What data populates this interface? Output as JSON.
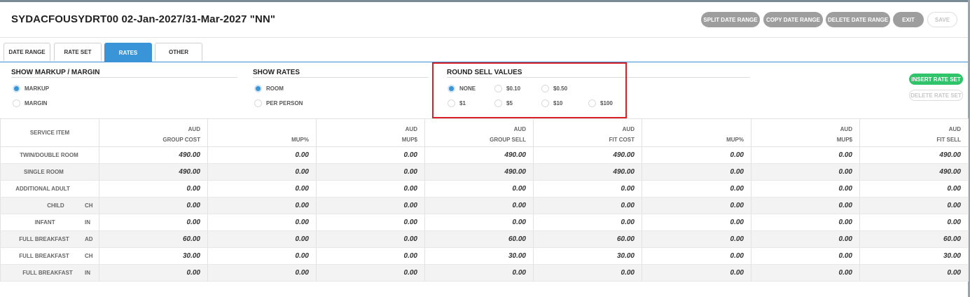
{
  "header": {
    "title": "SYDACFOUSYDRT00 02-Jan-2027/31-Mar-2027 \"NN\"",
    "buttons": {
      "split": "SPLIT DATE RANGE",
      "copy": "COPY DATE RANGE",
      "delete": "DELETE DATE RANGE",
      "exit": "EXIT",
      "save": "SAVE"
    }
  },
  "tabs": [
    "DATE RANGE",
    "RATE SET",
    "RATES",
    "OTHER"
  ],
  "active_tab": "RATES",
  "show_markup": {
    "title": "SHOW MARKUP / MARGIN",
    "options": [
      "MARKUP",
      "MARGIN"
    ],
    "selected": "MARKUP"
  },
  "show_rates": {
    "title": "SHOW RATES",
    "options": [
      "ROOM",
      "PER PERSON"
    ],
    "selected": "ROOM"
  },
  "round_sell": {
    "title": "ROUND SELL VALUES",
    "options": [
      "NONE",
      "$0.10",
      "$0.50",
      "$1",
      "$5",
      "$10",
      "$100"
    ],
    "selected": "NONE"
  },
  "rate_set_buttons": {
    "insert": "INSERT RATE SET",
    "delete": "DELETE RATE SET"
  },
  "table": {
    "columns": [
      {
        "l1": "",
        "l2": "SERVICE ITEM"
      },
      {
        "l1": "AUD",
        "l2": "GROUP COST"
      },
      {
        "l1": "",
        "l2": "MUP%"
      },
      {
        "l1": "AUD",
        "l2": "MUP$"
      },
      {
        "l1": "AUD",
        "l2": "GROUP SELL"
      },
      {
        "l1": "AUD",
        "l2": "FIT COST"
      },
      {
        "l1": "",
        "l2": "MUP%"
      },
      {
        "l1": "AUD",
        "l2": "MUP$"
      },
      {
        "l1": "AUD",
        "l2": "FIT SELL"
      }
    ],
    "rows": [
      {
        "item": "TWIN/DOUBLE ROOM",
        "code": "",
        "values": [
          "490.00",
          "0.00",
          "0.00",
          "490.00",
          "490.00",
          "0.00",
          "0.00",
          "490.00"
        ]
      },
      {
        "item": "SINGLE ROOM",
        "code": "",
        "values": [
          "490.00",
          "0.00",
          "0.00",
          "490.00",
          "490.00",
          "0.00",
          "0.00",
          "490.00"
        ]
      },
      {
        "item": "ADDITIONAL ADULT",
        "code": "",
        "values": [
          "0.00",
          "0.00",
          "0.00",
          "0.00",
          "0.00",
          "0.00",
          "0.00",
          "0.00"
        ]
      },
      {
        "item": "CHILD",
        "code": "CH",
        "values": [
          "0.00",
          "0.00",
          "0.00",
          "0.00",
          "0.00",
          "0.00",
          "0.00",
          "0.00"
        ]
      },
      {
        "item": "INFANT",
        "code": "IN",
        "values": [
          "0.00",
          "0.00",
          "0.00",
          "0.00",
          "0.00",
          "0.00",
          "0.00",
          "0.00"
        ]
      },
      {
        "item": "FULL BREAKFAST",
        "code": "AD",
        "values": [
          "60.00",
          "0.00",
          "0.00",
          "60.00",
          "60.00",
          "0.00",
          "0.00",
          "60.00"
        ]
      },
      {
        "item": "FULL BREAKFAST",
        "code": "CH",
        "values": [
          "30.00",
          "0.00",
          "0.00",
          "30.00",
          "30.00",
          "0.00",
          "0.00",
          "30.00"
        ]
      },
      {
        "item": "FULL BREAKFAST",
        "code": "IN",
        "values": [
          "0.00",
          "0.00",
          "0.00",
          "0.00",
          "0.00",
          "0.00",
          "0.00",
          "0.00"
        ]
      }
    ]
  }
}
